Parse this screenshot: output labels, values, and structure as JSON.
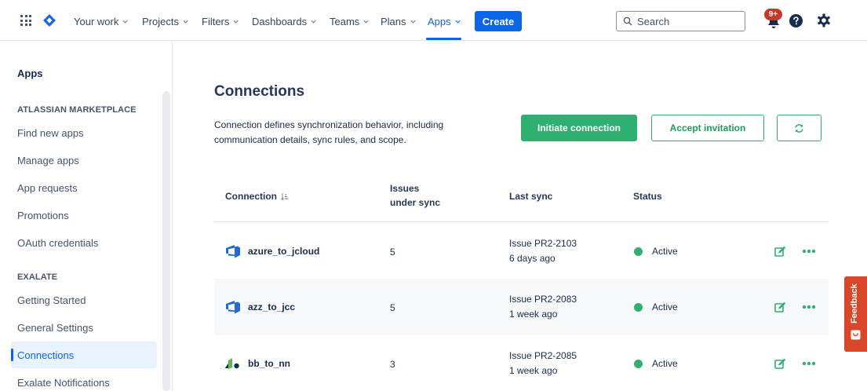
{
  "nav": {
    "items": [
      {
        "label": "Your work",
        "active": false
      },
      {
        "label": "Projects",
        "active": false
      },
      {
        "label": "Filters",
        "active": false
      },
      {
        "label": "Dashboards",
        "active": false
      },
      {
        "label": "Teams",
        "active": false
      },
      {
        "label": "Plans",
        "active": false
      },
      {
        "label": "Apps",
        "active": true
      }
    ],
    "create_label": "Create",
    "search_placeholder": "Search",
    "notification_badge": "9+",
    "accent_color": "#0c66e4"
  },
  "sidebar": {
    "title": "Apps",
    "sections": [
      {
        "label": "ATLASSIAN MARKETPLACE",
        "items": [
          "Find new apps",
          "Manage apps",
          "App requests",
          "Promotions",
          "OAuth credentials"
        ]
      },
      {
        "label": "EXALATE",
        "items": [
          "Getting Started",
          "General Settings",
          "Connections",
          "Exalate Notifications"
        ]
      }
    ],
    "active_item": "Connections"
  },
  "main": {
    "title": "Connections",
    "description": "Connection defines synchronization behavior, including communication details, sync rules, and scope.",
    "initiate_label": "Initiate connection",
    "accept_label": "Accept invitation",
    "table": {
      "headers": {
        "connection": "Connection",
        "issues_line1": "Issues",
        "issues_line2": "under sync",
        "last_sync": "Last sync",
        "status": "Status"
      },
      "rows": [
        {
          "name": "azure_to_jcloud",
          "icon": "azure-devops-icon",
          "issues": "5",
          "sync_issue": "Issue PR2-2103",
          "sync_time": "6 days ago",
          "status": "Active"
        },
        {
          "name": "azz_to_jcc",
          "icon": "azure-devops-icon",
          "issues": "5",
          "sync_issue": "Issue PR2-2083",
          "sync_time": "1 week ago",
          "status": "Active"
        },
        {
          "name": "bb_to_nn",
          "icon": "zendesk-icon",
          "issues": "3",
          "sync_issue": "Issue PR2-2085",
          "sync_time": "1 week ago",
          "status": "Active"
        }
      ]
    },
    "status_color": "#2fb071"
  },
  "feedback_label": "Feedback"
}
